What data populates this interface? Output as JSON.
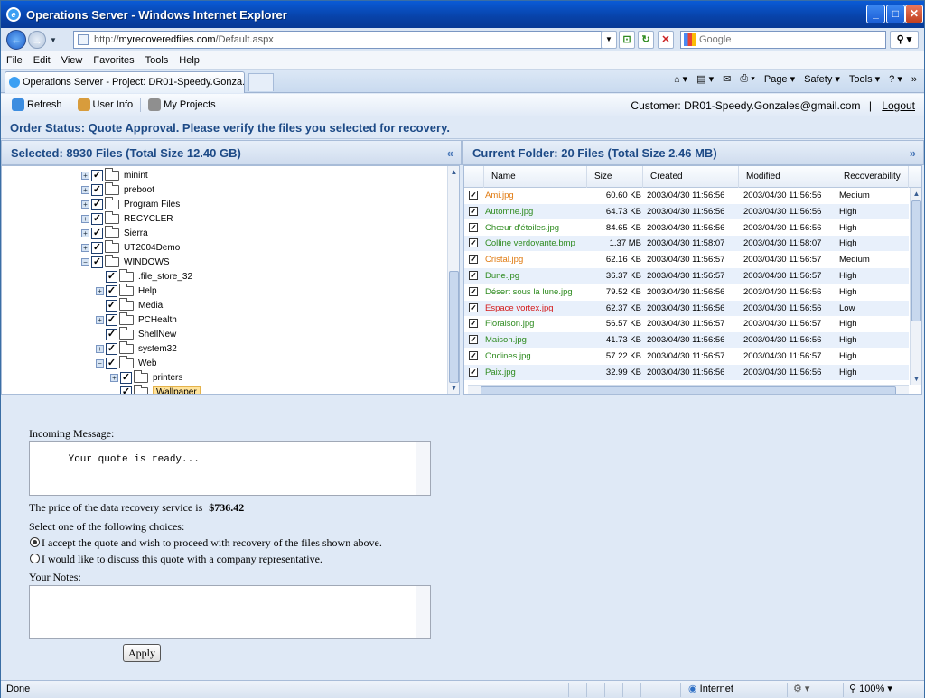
{
  "window": {
    "title": "Operations Server -  Windows Internet Explorer"
  },
  "address": {
    "prefix": "http://",
    "domain": "myrecoveredfiles.com",
    "path": "/Default.aspx"
  },
  "search": {
    "placeholder": "Google"
  },
  "menu": [
    "File",
    "Edit",
    "View",
    "Favorites",
    "Tools",
    "Help"
  ],
  "tab": {
    "label": "Operations Server - Project: DR01-Speedy.Gonza..."
  },
  "commandbar": {
    "page": "Page",
    "safety": "Safety",
    "tools": "Tools",
    "more": "»"
  },
  "toolbar": {
    "refresh": "Refresh",
    "user_info": "User Info",
    "my_projects": "My Projects",
    "customer": "Customer: DR01-Speedy.Gonzales@gmail.com",
    "separator": "|",
    "logout": "Logout"
  },
  "order_status": "Order Status: Quote Approval. Please verify the files you selected for recovery.",
  "left_panel": {
    "title": "Selected: 8930 Files (Total Size 12.40 GB)",
    "collapse": "«"
  },
  "right_panel": {
    "title": "Current Folder: 20 Files (Total Size 2.46 MB)",
    "expand": "»"
  },
  "tree": [
    {
      "label": "minint",
      "plus": true
    },
    {
      "label": "preboot",
      "plus": true
    },
    {
      "label": "Program Files",
      "plus": true
    },
    {
      "label": "RECYCLER",
      "plus": true
    },
    {
      "label": "Sierra",
      "plus": true
    },
    {
      "label": "UT2004Demo",
      "plus": true
    },
    {
      "label": "WINDOWS",
      "plus": "minus"
    },
    {
      "label": ".file_store_32",
      "plus": false
    },
    {
      "label": "Help",
      "plus": true
    },
    {
      "label": "Media",
      "plus": false
    },
    {
      "label": "PCHealth",
      "plus": true
    },
    {
      "label": "ShellNew",
      "plus": false
    },
    {
      "label": "system32",
      "plus": true
    },
    {
      "label": "Web",
      "plus": "minus"
    },
    {
      "label": "printers",
      "plus": true
    },
    {
      "label": "Wallpaper",
      "plus": false,
      "selected": true
    }
  ],
  "grid": {
    "columns": [
      "Name",
      "Size",
      "Created",
      "Modified",
      "Recoverability"
    ],
    "rows": [
      {
        "name": "Ami.jpg",
        "size": "60.60 KB",
        "created": "2003/04/30 11:56:56",
        "modified": "2003/04/30 11:56:56",
        "rec": "Medium",
        "color": "#e07a10"
      },
      {
        "name": "Automne.jpg",
        "size": "64.73 KB",
        "created": "2003/04/30 11:56:56",
        "modified": "2003/04/30 11:56:56",
        "rec": "High",
        "color": "#2e8b1f"
      },
      {
        "name": "Chœur d'étoiles.jpg",
        "size": "84.65 KB",
        "created": "2003/04/30 11:56:56",
        "modified": "2003/04/30 11:56:56",
        "rec": "High",
        "color": "#2e8b1f"
      },
      {
        "name": "Colline verdoyante.bmp",
        "size": "1.37 MB",
        "created": "2003/04/30 11:58:07",
        "modified": "2003/04/30 11:58:07",
        "rec": "High",
        "color": "#2e8b1f"
      },
      {
        "name": "Cristal.jpg",
        "size": "62.16 KB",
        "created": "2003/04/30 11:56:57",
        "modified": "2003/04/30 11:56:57",
        "rec": "Medium",
        "color": "#e07a10"
      },
      {
        "name": "Dune.jpg",
        "size": "36.37 KB",
        "created": "2003/04/30 11:56:57",
        "modified": "2003/04/30 11:56:57",
        "rec": "High",
        "color": "#2e8b1f"
      },
      {
        "name": "Désert sous la lune.jpg",
        "size": "79.52 KB",
        "created": "2003/04/30 11:56:56",
        "modified": "2003/04/30 11:56:56",
        "rec": "High",
        "color": "#2e8b1f"
      },
      {
        "name": "Espace vortex.jpg",
        "size": "62.37 KB",
        "created": "2003/04/30 11:56:56",
        "modified": "2003/04/30 11:56:56",
        "rec": "Low",
        "color": "#d41a1a"
      },
      {
        "name": "Floraison.jpg",
        "size": "56.57 KB",
        "created": "2003/04/30 11:56:57",
        "modified": "2003/04/30 11:56:57",
        "rec": "High",
        "color": "#2e8b1f"
      },
      {
        "name": "Maison.jpg",
        "size": "41.73 KB",
        "created": "2003/04/30 11:56:56",
        "modified": "2003/04/30 11:56:56",
        "rec": "High",
        "color": "#2e8b1f"
      },
      {
        "name": "Ondines.jpg",
        "size": "57.22 KB",
        "created": "2003/04/30 11:56:57",
        "modified": "2003/04/30 11:56:57",
        "rec": "High",
        "color": "#2e8b1f"
      },
      {
        "name": "Paix.jpg",
        "size": "32.99 KB",
        "created": "2003/04/30 11:56:56",
        "modified": "2003/04/30 11:56:56",
        "rec": "High",
        "color": "#2e8b1f"
      }
    ]
  },
  "form": {
    "incoming_label": "Incoming Message:",
    "incoming_text": "Your quote is ready...",
    "price_label": "The price of the data recovery service is",
    "price_value": "$736.42",
    "choices_label": "Select one of the following choices:",
    "choice_accept": "I accept the quote and wish to proceed with recovery of the files shown above.",
    "choice_discuss": "I would like to discuss this quote with a company representative.",
    "notes_label": "Your Notes:",
    "apply": "Apply"
  },
  "statusbar": {
    "left": "Done",
    "zone": "Internet",
    "zoom": "100%"
  }
}
